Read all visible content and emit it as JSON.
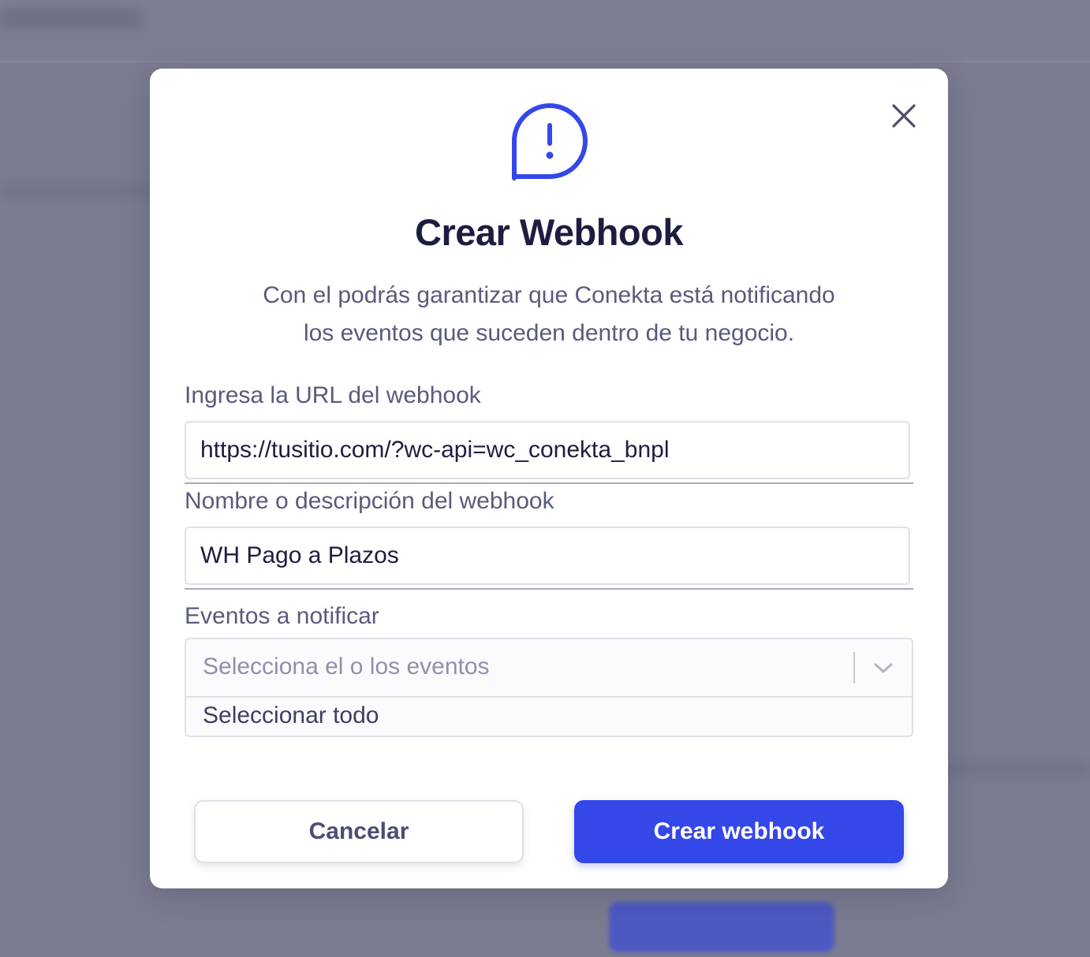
{
  "modal": {
    "title": "Crear Webhook",
    "subtitle_lines": [
      "Con el podrás garantizar que Conekta está notificando",
      "los eventos que suceden dentro de tu negocio."
    ],
    "icons": {
      "alert": "alert-bubble-icon",
      "close": "close-icon",
      "chevron": "chevron-down-icon"
    },
    "accent_color": "#3447e8"
  },
  "form": {
    "url": {
      "label": "Ingresa la URL del webhook",
      "value": "https://tusitio.com/?wc-api=wc_conekta_bnpl"
    },
    "name": {
      "label": "Nombre o descripción del webhook",
      "value": "WH Pago a Plazos"
    },
    "events": {
      "label": "Eventos a notificar",
      "placeholder": "Selecciona el o los eventos",
      "options": [
        "Seleccionar todo"
      ]
    }
  },
  "actions": {
    "cancel_label": "Cancelar",
    "create_label": "Crear webhook"
  }
}
